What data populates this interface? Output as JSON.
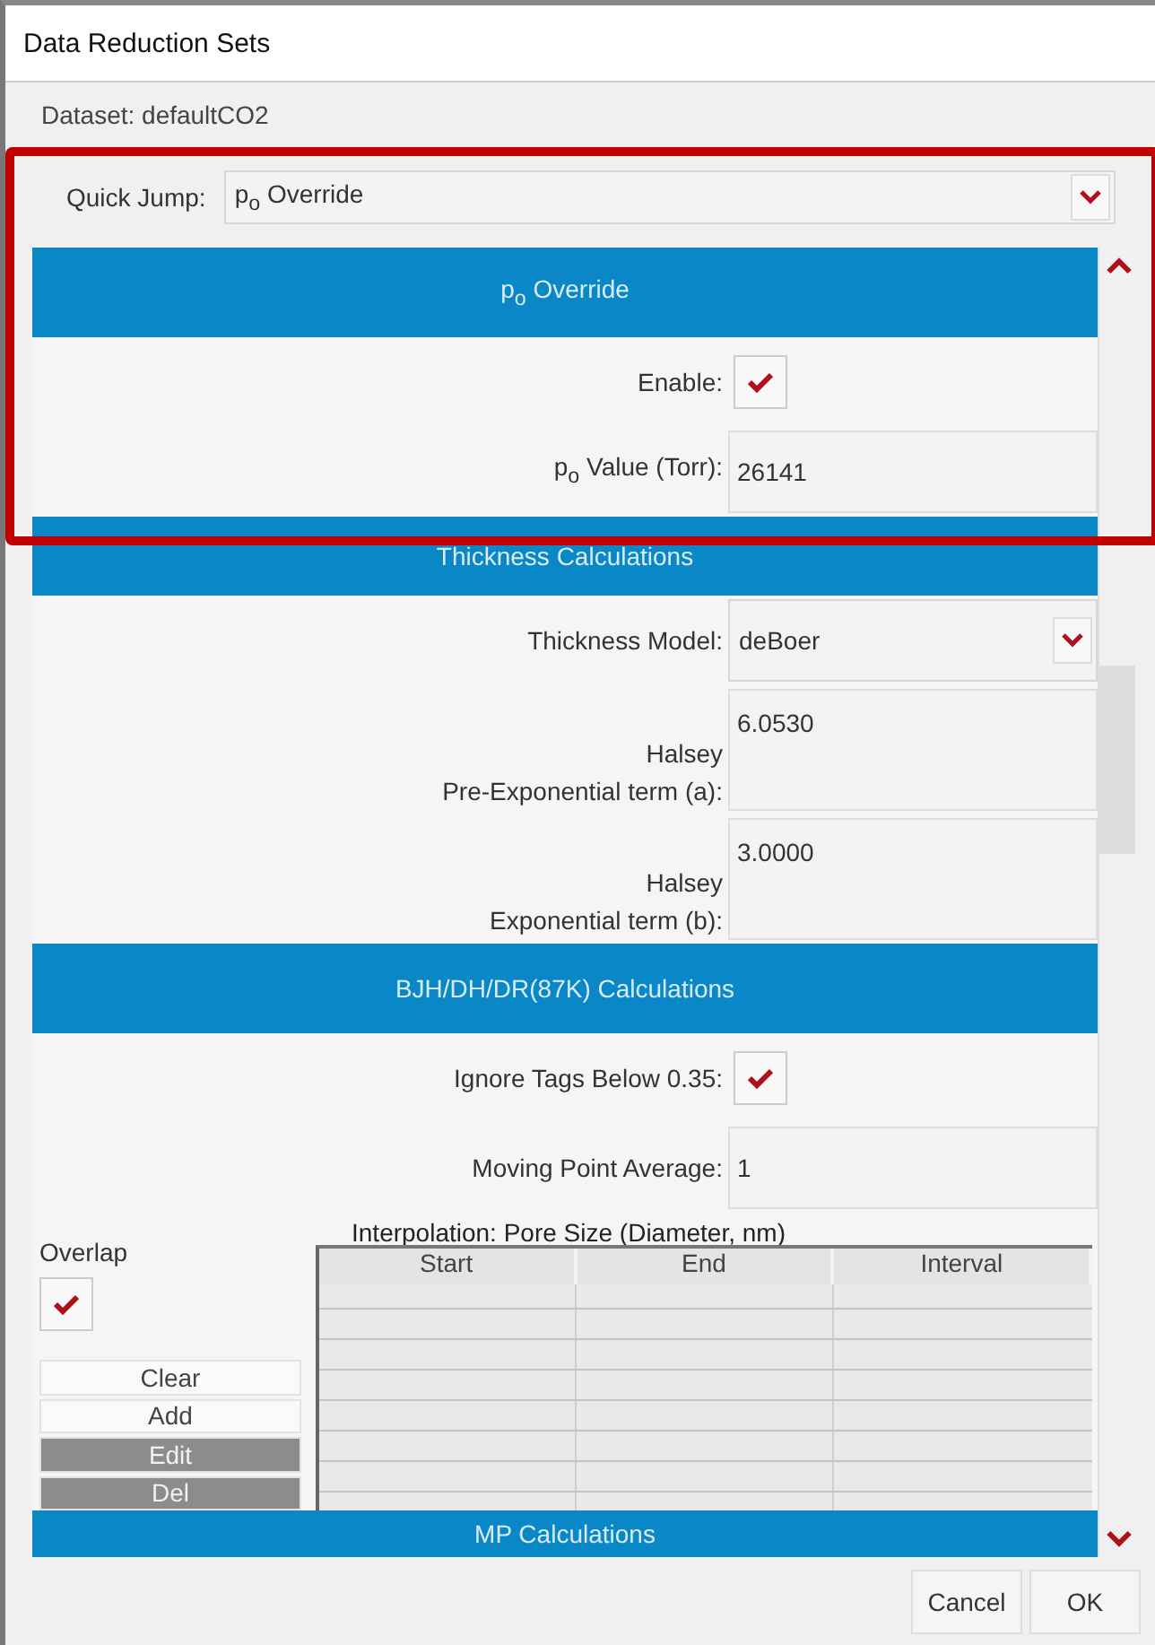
{
  "window": {
    "title": "Data Reduction Sets"
  },
  "dataset": "Dataset: defaultCO2",
  "quick_jump": {
    "label": "Quick Jump:",
    "value": "p$_{o}$ Override"
  },
  "sections": [
    {
      "title": "p$_{o}$ Override",
      "rows": [
        {
          "kind": "checkbox",
          "label": "Enable:",
          "checked": true
        },
        {
          "kind": "text",
          "label": "p$_{o}$ Value (Torr):",
          "value": "26141"
        }
      ]
    },
    {
      "title": "Thickness Calculations",
      "rows": [
        {
          "kind": "select",
          "label": "Thickness Model:",
          "value": "deBoer"
        },
        {
          "kind": "tall",
          "label": "Halsey\nPre-Exponential term (a):",
          "value": "6.0530"
        },
        {
          "kind": "tall",
          "label": "Halsey\nExponential term (b):",
          "value": "3.0000"
        }
      ]
    },
    {
      "title": "BJH/DH/DR(87K) Calculations",
      "rows": [
        {
          "kind": "checkbox",
          "label": "Ignore Tags Below 0.35:",
          "checked": true
        },
        {
          "kind": "text",
          "label": "Moving Point Average:",
          "value": "1"
        }
      ],
      "interpolation": {
        "title": "Interpolation:  Pore Size (Diameter, nm)",
        "overlap": {
          "label": "Overlap",
          "checked": true
        },
        "buttons": [
          {
            "label": "Clear",
            "disabled": false
          },
          {
            "label": "Add",
            "disabled": false
          },
          {
            "label": "Edit",
            "disabled": true
          },
          {
            "label": "Del",
            "disabled": true
          }
        ],
        "columns": [
          "Start",
          "End",
          "Interval"
        ]
      }
    },
    {
      "title": "MP Calculations"
    }
  ],
  "buttons": [
    "Cancel",
    "OK"
  ]
}
